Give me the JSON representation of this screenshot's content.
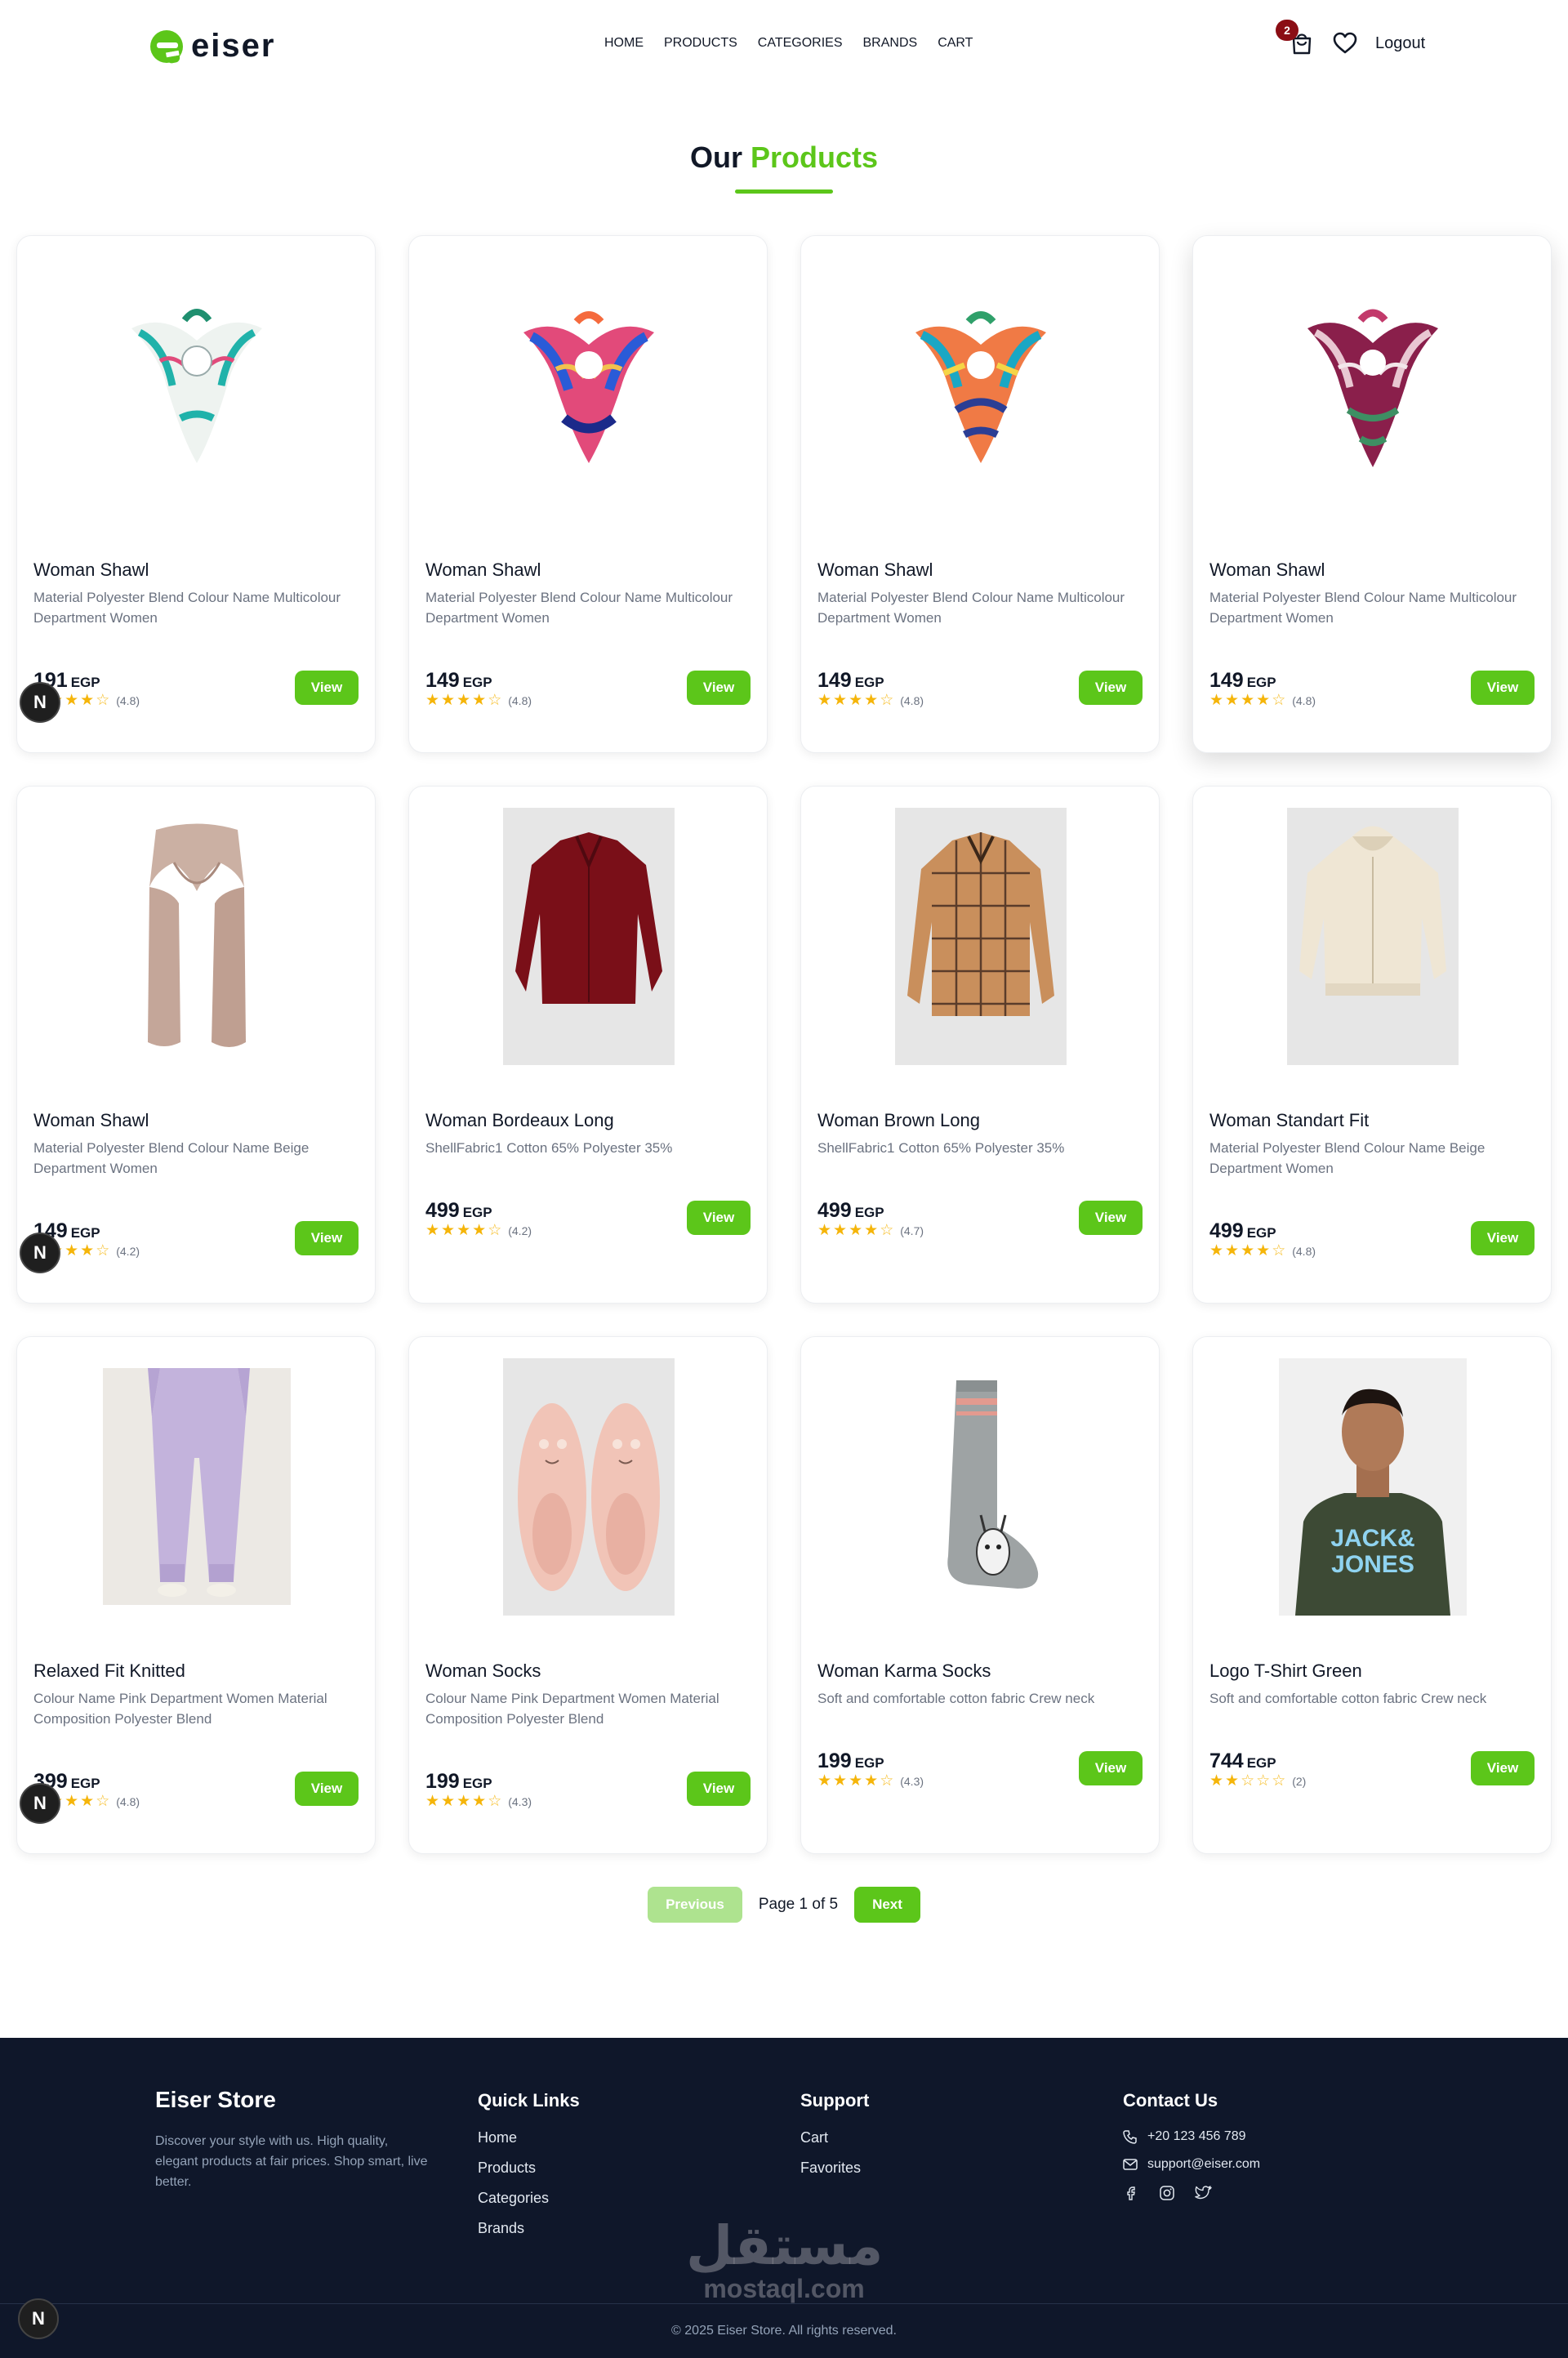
{
  "navbar": {
    "logo_text": "eiser",
    "links": [
      "HOME",
      "PRODUCTS",
      "CATEGORIES",
      "BRANDS",
      "CART"
    ],
    "cart_count": "2",
    "logout_label": "Logout"
  },
  "heading": {
    "part1": "Our",
    "part2": "Products"
  },
  "products": [
    {
      "title": "Woman Shawl",
      "desc": "Material Polyester Blend Colour Name Multicolour Department Women",
      "price": "191",
      "currency": "EGP",
      "rating": "(4.8)",
      "stars": 4
    },
    {
      "title": "Woman Shawl",
      "desc": "Material Polyester Blend Colour Name Multicolour Department Women",
      "price": "149",
      "currency": "EGP",
      "rating": "(4.8)",
      "stars": 4
    },
    {
      "title": "Woman Shawl",
      "desc": "Material Polyester Blend Colour Name Multicolour Department Women",
      "price": "149",
      "currency": "EGP",
      "rating": "(4.8)",
      "stars": 4
    },
    {
      "title": "Woman Shawl",
      "desc": "Material Polyester Blend Colour Name Multicolour Department Women",
      "price": "149",
      "currency": "EGP",
      "rating": "(4.8)",
      "stars": 4
    },
    {
      "title": "Woman Shawl",
      "desc": "Material Polyester Blend Colour Name Beige Department Women",
      "price": "149",
      "currency": "EGP",
      "rating": "(4.2)",
      "stars": 4
    },
    {
      "title": "Woman Bordeaux Long",
      "desc": "ShellFabric1 Cotton 65% Polyester 35%",
      "price": "499",
      "currency": "EGP",
      "rating": "(4.2)",
      "stars": 4
    },
    {
      "title": "Woman Brown Long",
      "desc": "ShellFabric1 Cotton 65% Polyester 35%",
      "price": "499",
      "currency": "EGP",
      "rating": "(4.7)",
      "stars": 4
    },
    {
      "title": "Woman Standart Fit",
      "desc": "Material Polyester Blend Colour Name Beige Department Women",
      "price": "499",
      "currency": "EGP",
      "rating": "(4.8)",
      "stars": 4
    },
    {
      "title": "Relaxed Fit Knitted",
      "desc": "Colour Name Pink Department Women Material Composition Polyester Blend",
      "price": "399",
      "currency": "EGP",
      "rating": "(4.8)",
      "stars": 4
    },
    {
      "title": "Woman Socks",
      "desc": "Colour Name Pink Department Women Material Composition Polyester Blend",
      "price": "199",
      "currency": "EGP",
      "rating": "(4.3)",
      "stars": 4
    },
    {
      "title": "Woman Karma Socks",
      "desc": "Soft and comfortable cotton fabric Crew neck",
      "price": "199",
      "currency": "EGP",
      "rating": "(4.3)",
      "stars": 4
    },
    {
      "title": "Logo T-Shirt Green",
      "desc": "Soft and comfortable cotton fabric Crew neck",
      "price": "744",
      "currency": "EGP",
      "rating": "(2)",
      "stars": 2
    }
  ],
  "view_label": "View",
  "floating_badge": "N",
  "pagination": {
    "previous": "Previous",
    "status": "Page 1 of 5",
    "next": "Next"
  },
  "footer": {
    "brand": "Eiser Store",
    "about": "Discover your style with us. High quality, elegant products at fair prices. Shop smart, live better.",
    "quick_links_title": "Quick Links",
    "quick_links": [
      "Home",
      "Products",
      "Categories",
      "Brands"
    ],
    "support_title": "Support",
    "support_links": [
      "Cart",
      "Favorites"
    ],
    "contact_title": "Contact Us",
    "phone": "+20 123 456 789",
    "email": "support@eiser.com",
    "copyright": "© 2025 Eiser Store. All rights reserved."
  },
  "watermark": {
    "arabic": "مستقل",
    "latin": "mostaql.com"
  },
  "colors": {
    "accent": "#5cc61a",
    "footer_bg": "#0f172a",
    "badge": "#8b0d14",
    "star": "#f5b50a"
  }
}
